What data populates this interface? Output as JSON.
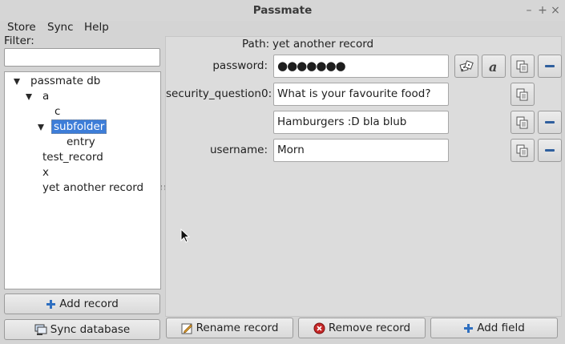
{
  "window": {
    "title": "Passmate",
    "controls": [
      "–",
      "+",
      "×"
    ]
  },
  "menu": [
    "Store",
    "Sync",
    "Help"
  ],
  "filter": {
    "label": "Filter:",
    "value": ""
  },
  "tree": {
    "root": "passmate db",
    "a": "a",
    "c": "c",
    "subfolder": "subfolder",
    "entry": "entry",
    "test_record": "test_record",
    "x": "x",
    "yet_another_record": "yet another record"
  },
  "record": {
    "path_label": "Path:",
    "path_value": "yet another record",
    "fields": [
      {
        "label": "password:",
        "value": "●●●●●●●"
      },
      {
        "label": "security_question0:",
        "value": "What is your favourite food?"
      },
      {
        "label": "",
        "value": "Hamburgers :D bla blub"
      },
      {
        "label": "username:",
        "value": "Morn"
      }
    ]
  },
  "buttons": {
    "add_record": "Add record",
    "sync_database": "Sync database",
    "rename_record": "Rename record",
    "remove_record": "Remove record",
    "add_field": "Add field"
  },
  "colors": {
    "selection": "#3d7dd8",
    "accent_blue": "#2f5f9e",
    "remove_red": "#c62828"
  },
  "icons": [
    "dice-icon",
    "font-icon",
    "copy-icon",
    "minus-icon",
    "plus-icon",
    "sync-icon",
    "edit-icon",
    "remove-icon"
  ]
}
